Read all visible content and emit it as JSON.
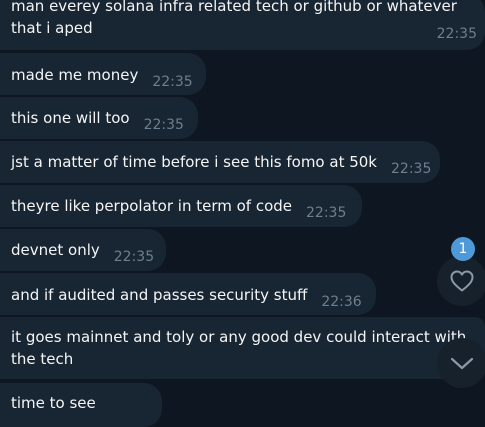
{
  "messages": [
    {
      "lines": [
        "man everey solana infra related tech or github or whatever",
        "that i aped"
      ],
      "time": "22:35"
    },
    {
      "text": "made me money",
      "time": "22:35"
    },
    {
      "text": "this one will too",
      "time": "22:35"
    },
    {
      "text": "jst a matter of time before i see this fomo at 50k",
      "time": "22:35"
    },
    {
      "text": "theyre like perpolator in term of code",
      "time": "22:35"
    },
    {
      "text": "devnet only",
      "time": "22:35"
    },
    {
      "text": "and if audited and passes security stuff",
      "time": "22:36"
    },
    {
      "lines": [
        "it goes mainnet and toly or any good dev could interact with",
        "the tech"
      ]
    },
    {
      "text": "time to see"
    }
  ],
  "reactions_badge": "1",
  "icons": {
    "reactions": "heart-icon",
    "scroll_down": "chevron-down-icon"
  },
  "colors": {
    "background": "#0e1621",
    "bubble": "#182533",
    "text": "#f5f5f5",
    "timestamp": "#6d7f8f",
    "badge": "#4e9ad8",
    "fab": "#17212b"
  }
}
